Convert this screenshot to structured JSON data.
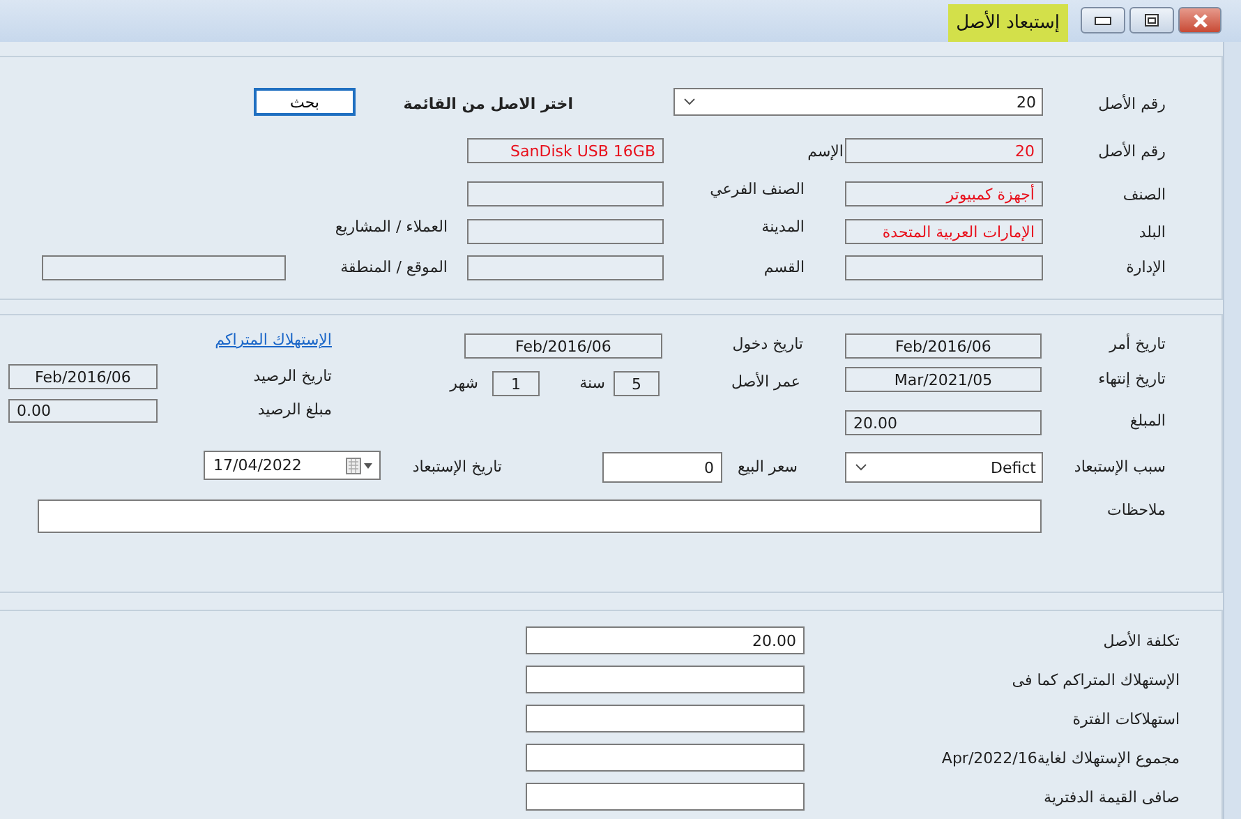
{
  "window": {
    "title": "إستبعاد الأصل"
  },
  "asset_section": {
    "items": [
      {
        "kind": "label",
        "text": "رقم الأصل"
      },
      {
        "kind": "combo",
        "value": "20"
      },
      {
        "kind": "heading",
        "text": "اختر الاصل من القائمة"
      },
      {
        "kind": "button",
        "text": "بحث"
      },
      {
        "kind": "label",
        "text": "رقم الأصل"
      },
      {
        "kind": "field",
        "value": "20",
        "color": "#e8101c",
        "readonly": true
      },
      {
        "kind": "label",
        "text": "الإسم"
      },
      {
        "kind": "field",
        "value": "SanDisk USB 16GB",
        "color": "#e8101c",
        "readonly": true
      },
      {
        "kind": "label",
        "text": "الصنف"
      },
      {
        "kind": "field",
        "value": "أجهزة كمبيوتر",
        "color": "#e8101c",
        "readonly": true
      },
      {
        "kind": "label",
        "text": "الصنف الفرعي"
      },
      {
        "kind": "field",
        "readonly": true
      },
      {
        "kind": "label",
        "text": "البلد"
      },
      {
        "kind": "field",
        "value": "الإمارات العربية المتحدة",
        "color": "#e8101c",
        "readonly": true
      },
      {
        "kind": "label",
        "text": "المدينة"
      },
      {
        "kind": "field",
        "readonly": true
      },
      {
        "kind": "label",
        "text": "العملاء / المشاريع"
      },
      {
        "kind": "label",
        "text": "الإدارة"
      },
      {
        "kind": "field",
        "readonly": true
      },
      {
        "kind": "label",
        "text": "القسم"
      },
      {
        "kind": "field",
        "readonly": true
      },
      {
        "kind": "label",
        "text": "الموقع / المنطقة"
      },
      {
        "kind": "field",
        "readonly": true
      }
    ]
  },
  "dates_section": {
    "items": [
      {
        "kind": "label",
        "text": "تاريخ أمر"
      },
      {
        "kind": "field",
        "value": "Feb/2016/06",
        "readonly": true
      },
      {
        "kind": "label",
        "text": "تاريخ دخول"
      },
      {
        "kind": "field",
        "value": "Feb/2016/06",
        "readonly": true
      },
      {
        "kind": "link",
        "text": "الإستهلاك المتراكم"
      },
      {
        "kind": "label",
        "text": "تاريخ إنتهاء"
      },
      {
        "kind": "field",
        "value": "Mar/2021/05",
        "readonly": true
      },
      {
        "kind": "label",
        "text": "عمر الأصل"
      },
      {
        "kind": "field",
        "value": "5",
        "readonly": true
      },
      {
        "kind": "label",
        "text": "سنة"
      },
      {
        "kind": "field",
        "value": "1",
        "readonly": true
      },
      {
        "kind": "label",
        "text": "شهر"
      },
      {
        "kind": "label",
        "text": "تاريخ الرصيد"
      },
      {
        "kind": "field",
        "value": "Feb/2016/06",
        "readonly": true
      },
      {
        "kind": "label",
        "text": "مبلغ الرصيد"
      },
      {
        "kind": "field",
        "value": "0.00",
        "readonly": true
      },
      {
        "kind": "label",
        "text": "المبلغ"
      },
      {
        "kind": "field",
        "value": "20.00",
        "readonly": true
      },
      {
        "kind": "label",
        "text": "سبب الإستبعاد"
      },
      {
        "kind": "combo",
        "value": "Defict"
      },
      {
        "kind": "label",
        "text": "سعر البيع"
      },
      {
        "kind": "field",
        "value": "0",
        "readonly": false
      },
      {
        "kind": "label",
        "text": "تاريخ الإستبعاد"
      },
      {
        "kind": "date",
        "value": "17/04/2022"
      },
      {
        "kind": "label",
        "text": "ملاحظات"
      },
      {
        "kind": "textarea"
      }
    ]
  },
  "totals_section": {
    "items": [
      {
        "kind": "label",
        "text": "تكلفة الأصل"
      },
      {
        "kind": "field",
        "value": "20.00",
        "readonly": false
      },
      {
        "kind": "label",
        "text": "الإستهلاك المتراكم كما فى"
      },
      {
        "kind": "field",
        "readonly": false
      },
      {
        "kind": "label",
        "text": "استهلاكات الفترة"
      },
      {
        "kind": "field",
        "readonly": false
      },
      {
        "kind": "label",
        "text": "مجموع الإستهلاك لغايةApr/2022/16"
      },
      {
        "kind": "field",
        "readonly": false
      },
      {
        "kind": "label",
        "text": "صافى القيمة الدفترية"
      },
      {
        "kind": "field",
        "readonly": false
      }
    ]
  }
}
